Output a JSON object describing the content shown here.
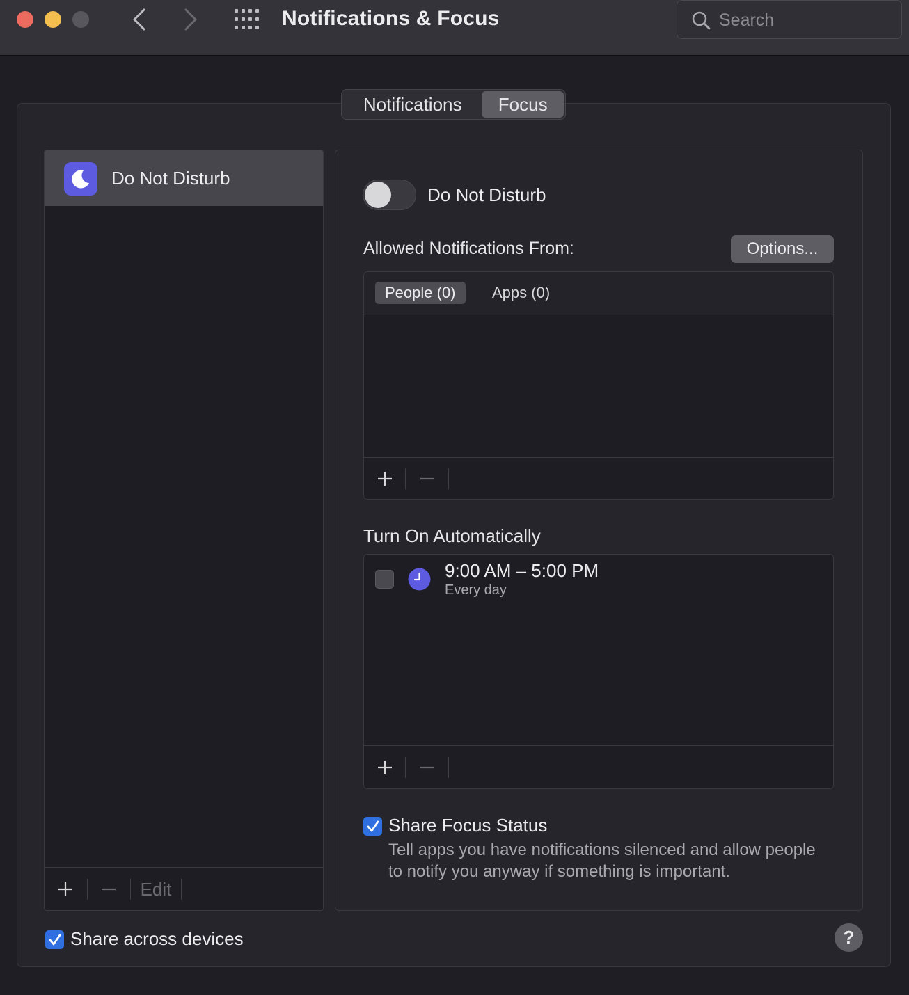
{
  "window": {
    "title": "Notifications & Focus",
    "search_placeholder": "Search"
  },
  "tabs": [
    {
      "label": "Notifications",
      "selected": false
    },
    {
      "label": "Focus",
      "selected": true
    }
  ],
  "sidebar": {
    "items": [
      {
        "label": "Do Not Disturb",
        "icon": "moon-icon",
        "icon_color": "#5d5ce0",
        "selected": true
      }
    ],
    "footer": {
      "add": "+",
      "remove": "—",
      "edit": "Edit"
    }
  },
  "detail": {
    "toggle_label": "Do Not Disturb",
    "toggle_on": false,
    "allowed_label": "Allowed Notifications From:",
    "options_button": "Options...",
    "allowed_tabs": [
      {
        "label": "People (0)",
        "selected": true
      },
      {
        "label": "Apps (0)",
        "selected": false
      }
    ],
    "allowed_footer": {
      "add": "+",
      "remove": "—"
    },
    "auto_label": "Turn On Automatically",
    "schedule": {
      "enabled": false,
      "time": "9:00 AM – 5:00 PM",
      "repeat": "Every day",
      "icon": "clock-icon",
      "icon_color": "#5d5ce0"
    },
    "auto_footer": {
      "add": "+",
      "remove": "—"
    },
    "share_focus": {
      "checked": true,
      "label": "Share Focus Status",
      "description": "Tell apps you have notifications silenced and allow people to notify you anyway if something is important."
    }
  },
  "share_devices": {
    "checked": true,
    "label": "Share across devices"
  },
  "help": "?",
  "colors": {
    "accent_checkbox": "#2f6fe0",
    "focus_purple": "#5d5ce0",
    "close": "#ed6a5e",
    "minimize": "#f5bf4f"
  }
}
